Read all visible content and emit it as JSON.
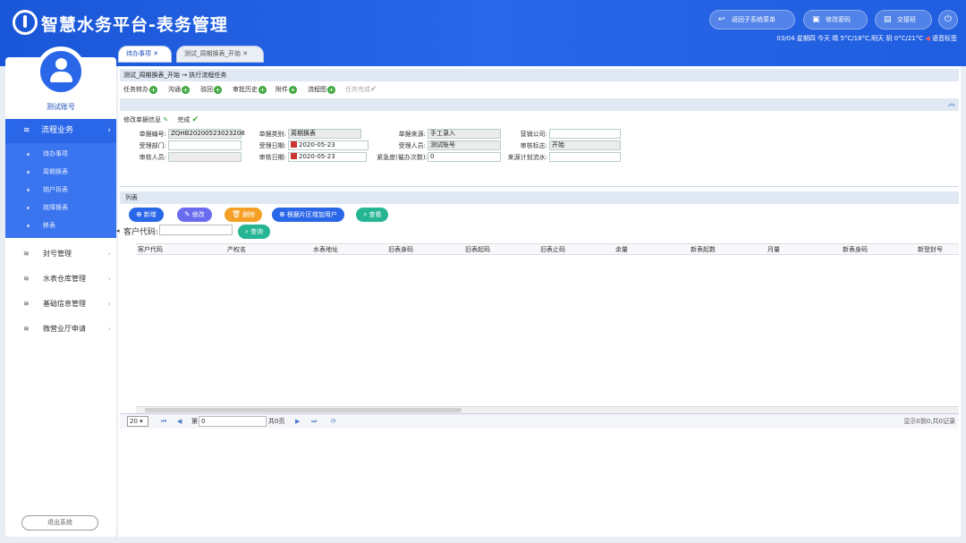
{
  "app": {
    "title": "智慧水务平台-表务管理"
  },
  "header": {
    "return_label": "返回子系统菜单",
    "password_label": "修改密码",
    "shift_label": "交接班",
    "weather": "03/04 星期四 今天 晴 5°C/18°C,明天 阴 0°C/21°C",
    "voice": "语音标签"
  },
  "tabs": [
    {
      "label": "待办事项"
    },
    {
      "label": "测试_周期换表_开始"
    }
  ],
  "sidebar": {
    "user": "测试账号",
    "active": "流程业务",
    "sub_items": [
      "待办事项",
      "周期换表",
      "销户拆表",
      "故障换表",
      "移表"
    ],
    "items": [
      "封号管理",
      "水表仓库管理",
      "基础信息管理",
      "微营业厅申请"
    ],
    "logout": "退出系统"
  },
  "breadcrumb": "测试_周期换表_开始 → 执行流程任务",
  "toolbar": {
    "items": [
      "任务转办",
      "沟通",
      "驳回",
      "审批历史",
      "附件",
      "流程图"
    ],
    "complete": "任务完成"
  },
  "form": {
    "edit_label": "修改单据信息",
    "done_label": "完成",
    "labels": {
      "doc_no": "单据编号:",
      "doc_type": "单据类别:",
      "source": "单据来源:",
      "company": "营销公司:",
      "dept": "受理部门:",
      "accept_date": "受理日期:",
      "acceptor": "受理人员:",
      "audit_flag": "审核标志:",
      "auditor": "审核人员:",
      "audit_date": "审核日期:",
      "urgency": "紧急度(催办次数):",
      "plan_no": "来源计划流水:"
    },
    "values": {
      "doc_no": "ZQHB20200523023208",
      "doc_type": "周期换表",
      "source": "手工录入",
      "company": "",
      "dept": "",
      "accept_date": "2020-05-23",
      "acceptor": "测试账号",
      "audit_flag": "开始",
      "auditor": "",
      "audit_date": "2020-05-23",
      "urgency": "0",
      "plan_no": ""
    }
  },
  "list": {
    "title": "列表",
    "buttons": {
      "add": "新增",
      "edit": "修改",
      "delete": "删除",
      "add_by_area": "根据片区增加用户",
      "view": "查看"
    },
    "search_label": "客户代码:",
    "search_button": "查询",
    "columns": [
      "客户代码",
      "产权名",
      "水表地址",
      "旧表身码",
      "旧表起码",
      "旧表止码",
      "余量",
      "新表起数",
      "月量",
      "新表身码",
      "新登封号"
    ]
  },
  "pager": {
    "page_size": "20",
    "page_label": "第",
    "page_value": "0",
    "total_pages": "共0页",
    "info": "显示0到0,共0记录"
  },
  "colors": {
    "brand": "#2a66e8",
    "add": "#2a66e8",
    "edit": "#6a6cf0",
    "delete": "#f5a025",
    "area": "#2a66e8",
    "view": "#25b592"
  }
}
